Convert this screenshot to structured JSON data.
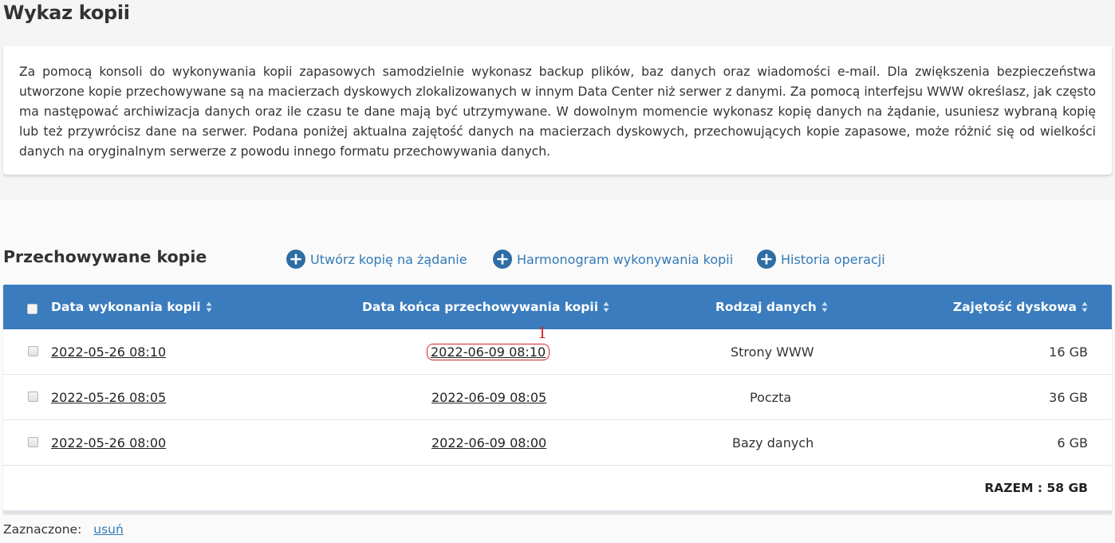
{
  "page": {
    "title": "Wykaz kopii",
    "info_text": "Za pomocą konsoli do wykonywania kopii zapasowych samodzielnie wykonasz backup plików, baz danych oraz wiadomości e-mail. Dla zwiększenia bezpieczeństwa utworzone kopie przechowywane są na macierzach dyskowych zlokalizowanych w innym Data Center niż serwer z danymi. Za pomocą interfejsu WWW określasz, jak często ma następować archiwizacja danych oraz ile czasu te dane mają być utrzymywane. W dowolnym momencie wykonasz kopię danych na żądanie, usuniesz wybraną kopię lub też przywrócisz dane na serwer. Podana poniżej aktualna zajętość danych na macierzach dyskowych, przechowujących kopie zapasowe, może różnić się od wielkości danych na oryginalnym serwerze z powodu innego formatu przechowywania danych."
  },
  "section": {
    "title": "Przechowywane kopie",
    "actions": {
      "create": "Utwórz kopię na żądanie",
      "schedule": "Harmonogram wykonywania kopii",
      "history": "Historia operacji"
    }
  },
  "table": {
    "headers": {
      "date_created": "Data wykonania kopii",
      "date_expiry": "Data końca przechowywania kopii",
      "data_type": "Rodzaj danych",
      "disk_usage": "Zajętość dyskowa"
    },
    "rows": [
      {
        "created": "2022-05-26 08:10",
        "expiry": "2022-06-09 08:10",
        "type": "Strony WWW",
        "size": "16 GB"
      },
      {
        "created": "2022-05-26 08:05",
        "expiry": "2022-06-09 08:05",
        "type": "Poczta",
        "size": "36 GB"
      },
      {
        "created": "2022-05-26 08:00",
        "expiry": "2022-06-09 08:00",
        "type": "Bazy danych",
        "size": "6 GB"
      }
    ],
    "total": "RAZEM : 58 GB"
  },
  "annotation": {
    "marker": "1"
  },
  "footer": {
    "selected_label": "Zaznaczone:",
    "delete_link": "usuń"
  },
  "colors": {
    "header_bg": "#3a7cbd",
    "link": "#337ab7",
    "annotation": "#d0262a"
  }
}
